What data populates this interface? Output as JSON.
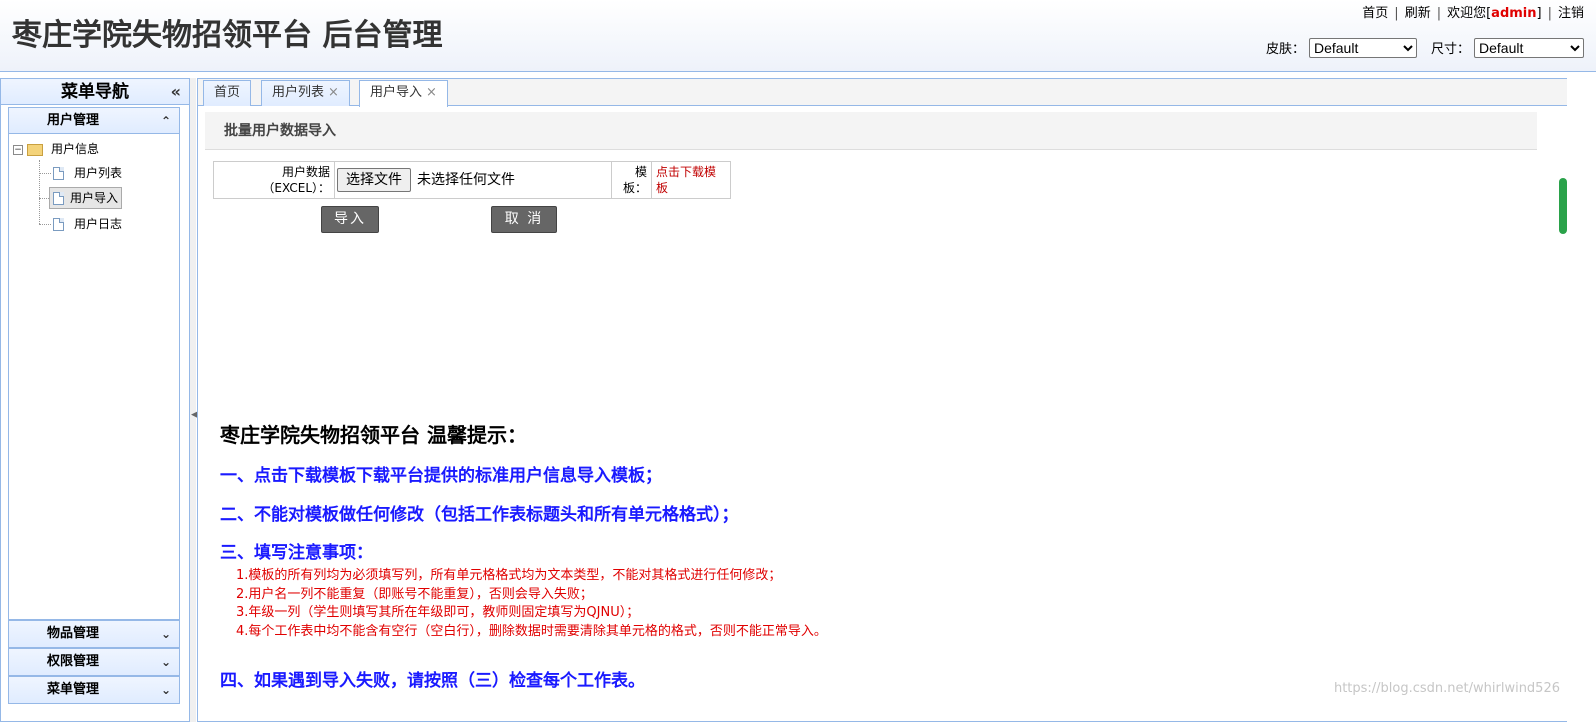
{
  "header": {
    "title": "枣庄学院失物招领平台 后台管理",
    "links": {
      "home": "首页",
      "refresh": "刷新",
      "welcome": "欢迎您[",
      "user": "admin",
      "welcome_end": "]",
      "logout": "注销"
    },
    "skin": {
      "label": "皮肤：",
      "value": "Default"
    },
    "size": {
      "label": "尺寸：",
      "value": "Default"
    }
  },
  "sidebar": {
    "title": "菜单导航",
    "collapse_icon": "«",
    "groups": [
      {
        "label": "用户管理",
        "expanded": true
      },
      {
        "label": "物品管理",
        "expanded": false
      },
      {
        "label": "权限管理",
        "expanded": false
      },
      {
        "label": "菜单管理",
        "expanded": false
      }
    ],
    "tree": {
      "root": "用户信息",
      "children": [
        "用户列表",
        "用户导入",
        "用户日志"
      ],
      "selected": "用户导入"
    }
  },
  "tabs": [
    {
      "label": "首页",
      "closable": false
    },
    {
      "label": "用户列表",
      "closable": true
    },
    {
      "label": "用户导入",
      "closable": true,
      "active": true
    }
  ],
  "tab_close": "×",
  "page": {
    "section_title": "批量用户数据导入",
    "form": {
      "data_label_1": "用户数据",
      "data_label_2": "（EXCEL）：",
      "choose_file": "选择文件",
      "no_file": "未选择任何文件",
      "template_label_1": "模",
      "template_label_2": "板：",
      "template_link_1": "点击下载模",
      "template_link_2": "板",
      "import_button": "导入",
      "cancel_button": "取 消"
    },
    "tips": {
      "title": "枣庄学院失物招领平台 温馨提示：",
      "step1": "一、点击下载模板下载平台提供的标准用户信息导入模板；",
      "step2": "二、不能对模板做任何修改（包括工作表标题头和所有单元格格式）；",
      "step3": "三、填写注意事项：",
      "notes": [
        "1.模板的所有列均为必须填写列，所有单元格格式均为文本类型，不能对其格式进行任何修改；",
        "2.用户名一列不能重复（即账号不能重复），否则会导入失败；",
        "3.年级一列（学生则填写其所在年级即可，教师则固定填写为QJNU）；",
        "4.每个工作表中均不能含有空行（空白行），删除数据时需要清除其单元格的格式，否则不能正常导入。"
      ],
      "step4": "四、如果遇到导入失败，请按照（三）检查每个工作表。"
    }
  },
  "watermark": "https://blog.csdn.net/whirlwind526",
  "colors": {
    "border": "#95b8e7",
    "tip_blue": "#1a1aff",
    "tip_red": "#e00000",
    "admin_red": "#e00000"
  }
}
